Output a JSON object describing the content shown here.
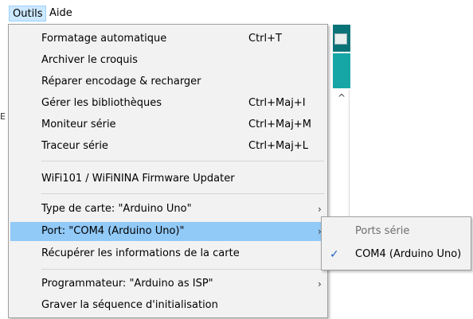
{
  "menubar": {
    "outils": "Outils",
    "aide": "Aide"
  },
  "menu": {
    "items": [
      {
        "label": "Formatage automatique",
        "shortcut": "Ctrl+T"
      },
      {
        "label": "Archiver le croquis",
        "shortcut": ""
      },
      {
        "label": "Réparer encodage & recharger",
        "shortcut": ""
      },
      {
        "label": "Gérer les bibliothèques",
        "shortcut": "Ctrl+Maj+I"
      },
      {
        "label": "Moniteur série",
        "shortcut": "Ctrl+Maj+M"
      },
      {
        "label": "Traceur série",
        "shortcut": "Ctrl+Maj+L"
      },
      {
        "label": "WiFi101 / WiFiNINA Firmware Updater",
        "shortcut": ""
      },
      {
        "label": "Type de carte: \"Arduino Uno\"",
        "shortcut": ""
      },
      {
        "label": "Port: \"COM4 (Arduino Uno)\"",
        "shortcut": ""
      },
      {
        "label": "Récupérer les informations de la carte",
        "shortcut": ""
      },
      {
        "label": "Programmateur: \"Arduino as ISP\"",
        "shortcut": ""
      },
      {
        "label": "Graver la séquence d'initialisation",
        "shortcut": ""
      }
    ],
    "submenu_arrow": "›",
    "hover_color": "#91c9f7"
  },
  "port_submenu": {
    "header": "Ports série",
    "item": "COM4 (Arduino Uno)",
    "check": "✓"
  },
  "background": {
    "scroll_up": "^",
    "left_mark": "E"
  },
  "colors": {
    "menu_bg": "#f2f2f2",
    "teal_dark": "#0a7377",
    "teal": "#17a6a6",
    "check": "#1f5fbf"
  }
}
